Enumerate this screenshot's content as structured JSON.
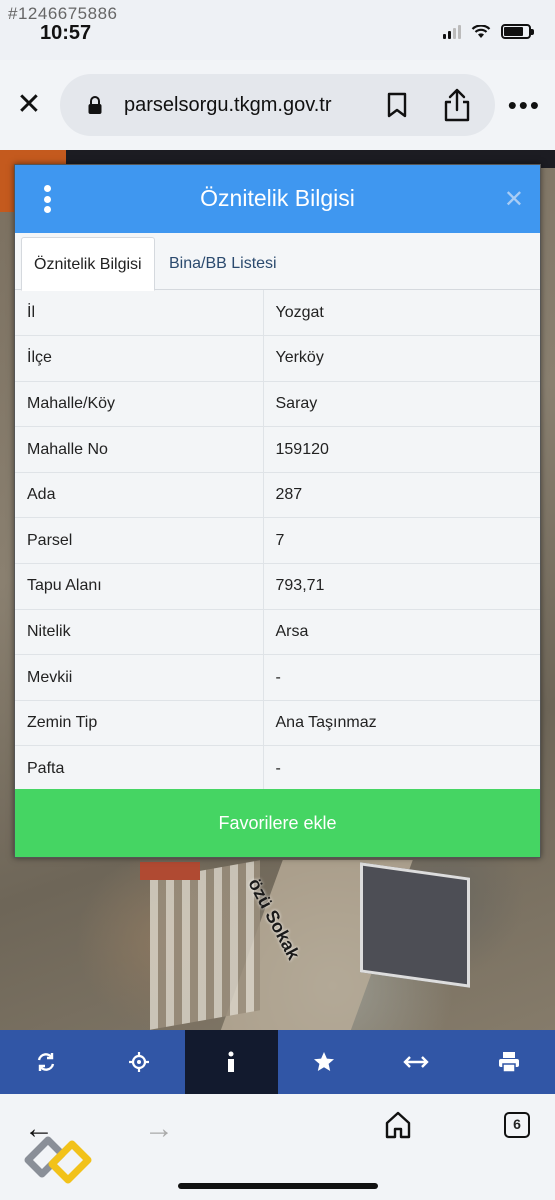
{
  "overlay": {
    "id_text": "#1246675886"
  },
  "status_bar": {
    "time": "10:57"
  },
  "browser": {
    "url": "parselsorgu.tkgm.gov.tr"
  },
  "map": {
    "street_label": "özü Sokak"
  },
  "modal": {
    "title": "Öznitelik Bilgisi",
    "tabs": [
      {
        "label": "Öznitelik Bilgisi",
        "active": true
      },
      {
        "label": "Bina/BB Listesi",
        "active": false
      }
    ],
    "rows": [
      {
        "label": "İl",
        "value": "Yozgat"
      },
      {
        "label": "İlçe",
        "value": "Yerköy"
      },
      {
        "label": "Mahalle/Köy",
        "value": "Saray"
      },
      {
        "label": "Mahalle No",
        "value": "159120"
      },
      {
        "label": "Ada",
        "value": "287"
      },
      {
        "label": "Parsel",
        "value": "7"
      },
      {
        "label": "Tapu Alanı",
        "value": "793,71"
      },
      {
        "label": "Nitelik",
        "value": "Arsa"
      },
      {
        "label": "Mevkii",
        "value": "-"
      },
      {
        "label": "Zemin Tip",
        "value": "Ana Taşınmaz"
      },
      {
        "label": "Pafta",
        "value": "-"
      }
    ],
    "favorite_button": "Favorilere ekle"
  },
  "toolbar": {
    "items": [
      "refresh-icon",
      "locate-icon",
      "info-icon",
      "star-icon",
      "measure-icon",
      "print-icon"
    ],
    "active_index": 2
  },
  "nav": {
    "tab_count": "6"
  },
  "colors": {
    "header": "#3f97f0",
    "favorite": "#45d563",
    "toolbar": "#3156a6"
  }
}
